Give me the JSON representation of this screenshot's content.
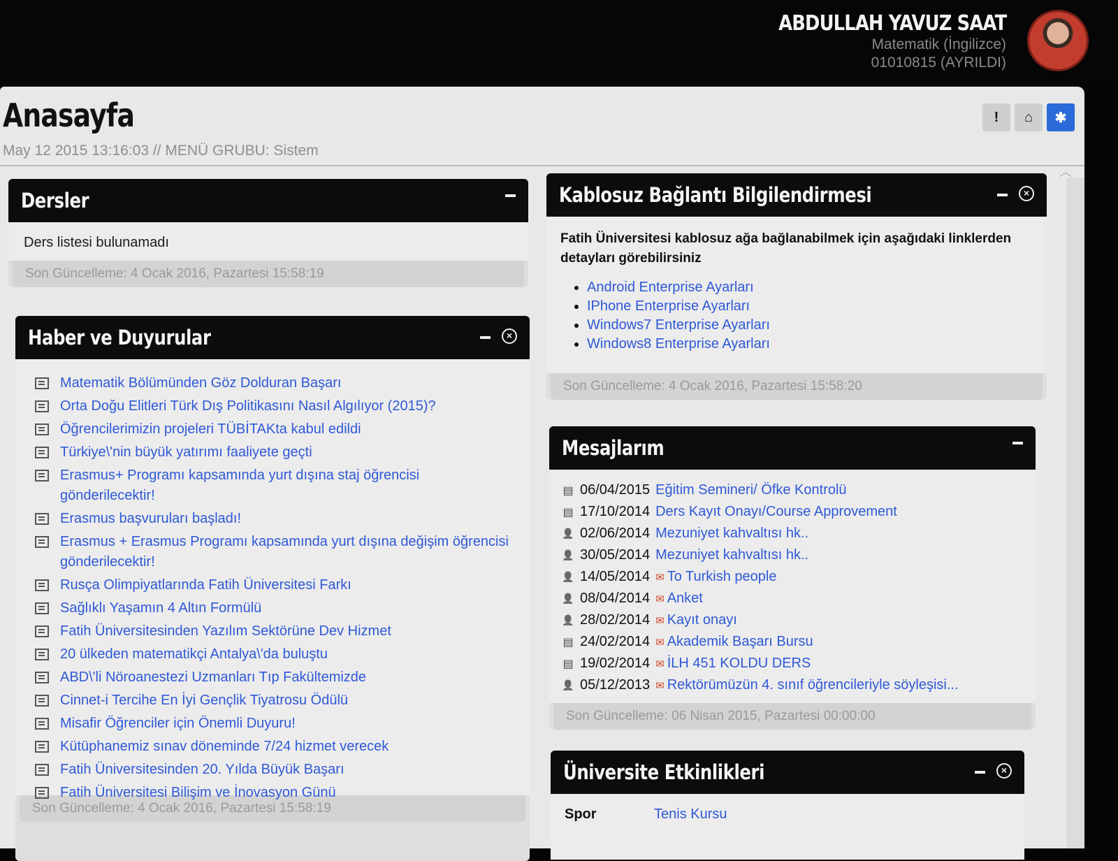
{
  "user": {
    "name": "ABDULLAH YAVUZ SAAT",
    "department": "Matematik (İngilizce)",
    "student_id": "01010815 (AYRILDI)"
  },
  "page": {
    "title": "Anasayfa",
    "subtitle": "May 12 2015 13:16:03 // MENÜ GRUBU: Sistem",
    "buttons": [
      {
        "icon": "exclamation-icon",
        "glyph": "!"
      },
      {
        "icon": "home-icon",
        "glyph": "⌂"
      },
      {
        "icon": "bug-icon",
        "glyph": "✱"
      }
    ]
  },
  "dersler": {
    "title": "Dersler",
    "message": "Ders listesi bulunamadı",
    "footer": "Son Güncelleme: 4 Ocak 2016, Pazartesi 15:58:19"
  },
  "haberler": {
    "title": "Haber ve Duyurular",
    "items": [
      "Matematik Bölümünden Göz Dolduran Başarı",
      "Orta Doğu Elitleri Türk Dış Politikasını Nasıl Algılıyor (2015)?",
      "Öğrencilerimizin projeleri TÜBİTAKta kabul edildi",
      "Türkiye\\'nin büyük yatırımı faaliyete geçti",
      "Erasmus+ Programı kapsamında yurt dışına staj öğrencisi gönderilecektir!",
      "Erasmus başvuruları başladı!",
      "Erasmus + Erasmus Programı kapsamında yurt dışına değişim öğrencisi gönderilecektir!",
      "Rusça Olimpiyatlarında Fatih Üniversitesi Farkı",
      "Sağlıklı Yaşamın 4 Altın Formülü",
      "Fatih Üniversitesinden Yazılım Sektörüne Dev Hizmet",
      "20 ülkeden matematikçi Antalya\\'da buluştu",
      "ABD\\'li Nöroanestezi Uzmanları Tıp Fakültemizde",
      "Cinnet-i Tercihe En İyi Gençlik Tiyatrosu Ödülü",
      "Misafir Öğrenciler için Önemli Duyuru!",
      "Kütüphanemiz sınav döneminde 7/24 hizmet verecek",
      "Fatih Üniversitesinden 20. Yılda Büyük Başarı",
      "Fatih Üniversitesi Bilişim ve İnovasyon Günü"
    ],
    "footer": "Son Güncelleme: 4 Ocak 2016, Pazartesi 15:58:19"
  },
  "kablosuz": {
    "title": "Kablosuz Bağlantı Bilgilendirmesi",
    "intro": "Fatih Üniversitesi kablosuz ağa bağlanabilmek için aşağıdaki linklerden detayları görebilirsiniz",
    "links": [
      "Android Enterprise Ayarları",
      "IPhone Enterprise Ayarları",
      "Windows7 Enterprise Ayarları",
      "Windows8 Enterprise Ayarları"
    ],
    "footer": "Son Güncelleme: 4 Ocak 2016, Pazartesi 15:58:20"
  },
  "mesajlar": {
    "title": "Mesajlarım",
    "items": [
      {
        "icon": "message-icon",
        "date": "06/04/2015",
        "flag": false,
        "subject": "Eğitim Semineri/ Öfke Kontrolü"
      },
      {
        "icon": "message-icon",
        "date": "17/10/2014",
        "flag": false,
        "subject": "Ders Kayıt Onayı/Course Approvement"
      },
      {
        "icon": "user-icon",
        "date": "02/06/2014",
        "flag": false,
        "subject": "Mezuniyet kahvaltısı hk.."
      },
      {
        "icon": "user-icon",
        "date": "30/05/2014",
        "flag": false,
        "subject": "Mezuniyet kahvaltısı hk.."
      },
      {
        "icon": "user-icon",
        "date": "14/05/2014",
        "flag": true,
        "subject": "To Turkish people"
      },
      {
        "icon": "user-icon",
        "date": "08/04/2014",
        "flag": true,
        "subject": "Anket"
      },
      {
        "icon": "user-icon",
        "date": "28/02/2014",
        "flag": true,
        "subject": "Kayıt onayı"
      },
      {
        "icon": "message-icon",
        "date": "24/02/2014",
        "flag": true,
        "subject": "Akademik Başarı Bursu"
      },
      {
        "icon": "message-icon",
        "date": "19/02/2014",
        "flag": true,
        "subject": "İLH 451 KOLDU DERS"
      },
      {
        "icon": "user-icon",
        "date": "05/12/2013",
        "flag": true,
        "subject": "Rektörümüzün 4. sınıf öğrencileriyle söyleşisi..."
      }
    ],
    "footer": "Son Güncelleme: 06 Nisan 2015, Pazartesi 00:00:00"
  },
  "etkinlikler": {
    "title": "Üniversite Etkinlikleri",
    "rows": [
      {
        "category": "Spor",
        "event": "Tenis Kursu"
      }
    ]
  },
  "colors": {
    "link": "#2f59d6",
    "header_bg": "#0c0c0c",
    "active_button": "#2a6ad9"
  }
}
